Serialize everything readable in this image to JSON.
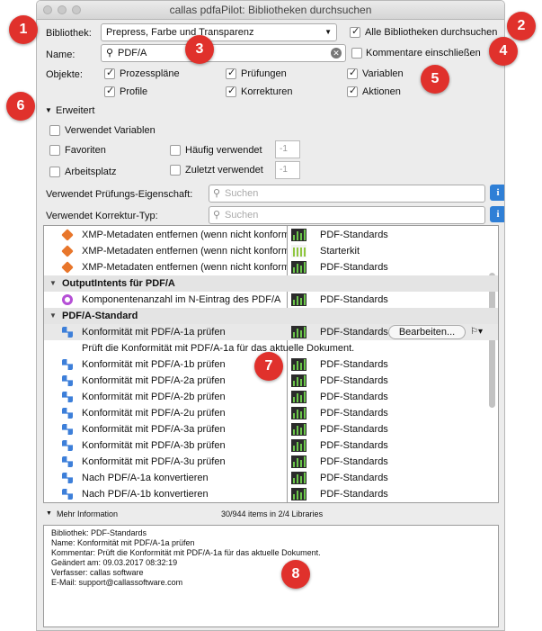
{
  "window": {
    "title": "callas pdfaPilot: Bibliotheken durchsuchen"
  },
  "form": {
    "library_label": "Bibliothek:",
    "library_value": "Prepress, Farbe und Transparenz",
    "all_libraries_label": "Alle Bibliotheken durchsuchen",
    "name_label": "Name:",
    "search_value": "PDF/A",
    "include_comments_label": "Kommentare einschließen",
    "objects_label": "Objekte:",
    "objects": [
      {
        "label": "Prozesspläne",
        "checked": true
      },
      {
        "label": "Prüfungen",
        "checked": true
      },
      {
        "label": "Variablen",
        "checked": true
      },
      {
        "label": "Profile",
        "checked": true
      },
      {
        "label": "Korrekturen",
        "checked": true
      },
      {
        "label": "Aktionen",
        "checked": true
      }
    ]
  },
  "advanced": {
    "toggle_label": "Erweitert",
    "uses_variables": "Verwendet Variablen",
    "favorites": "Favoriten",
    "workspace": "Arbeitsplatz",
    "frequently_used": "Häufig verwendet",
    "recently_used": "Zuletzt verwendet",
    "frequent_value": "-1",
    "recent_value": "-1",
    "check_property_label": "Verwendet Prüfungs-Eigenschaft:",
    "fixup_type_label": "Verwendet Korrektur-Typ:",
    "search_placeholder": "Suchen",
    "info_glyph": "i"
  },
  "list": {
    "rows": [
      {
        "kind": "item",
        "icon": "fixup-icon",
        "text": "XMP-Metadaten entfernen (wenn nicht konform)",
        "library": "PDF-Standards",
        "lib_icon": "library-chart-icon"
      },
      {
        "kind": "item",
        "icon": "fixup-icon",
        "text": "XMP-Metadaten entfernen (wenn nicht konform)",
        "library": "Starterkit",
        "lib_icon": "library-bars-icon"
      },
      {
        "kind": "item",
        "icon": "fixup-icon",
        "text": "XMP-Metadaten entfernen (wenn nicht konform)",
        "library": "PDF-Standards",
        "lib_icon": "library-chart-icon"
      },
      {
        "kind": "group",
        "text": "OutputIntents für PDF/A"
      },
      {
        "kind": "item",
        "icon": "check-circle-icon",
        "text": "Komponentenanzahl im N-Eintrag des PDF/A",
        "library": "PDF-Standards",
        "lib_icon": "library-chart-icon"
      },
      {
        "kind": "group",
        "text": "PDF/A-Standard"
      },
      {
        "kind": "item",
        "icon": "profile-icon",
        "text": "Konformität mit PDF/A-1a prüfen",
        "library": "PDF-Standards",
        "lib_icon": "library-chart-icon",
        "selected": true,
        "edit_label": "Bearbeiten..."
      },
      {
        "kind": "comment",
        "text": "Prüft die Konformität mit PDF/A-1a für das aktuelle Dokument."
      },
      {
        "kind": "item",
        "icon": "profile-icon",
        "text": "Konformität mit PDF/A-1b prüfen",
        "library": "PDF-Standards",
        "lib_icon": "library-chart-icon"
      },
      {
        "kind": "item",
        "icon": "profile-icon",
        "text": "Konformität mit PDF/A-2a prüfen",
        "library": "PDF-Standards",
        "lib_icon": "library-chart-icon"
      },
      {
        "kind": "item",
        "icon": "profile-icon",
        "text": "Konformität mit PDF/A-2b prüfen",
        "library": "PDF-Standards",
        "lib_icon": "library-chart-icon"
      },
      {
        "kind": "item",
        "icon": "profile-icon",
        "text": "Konformität mit PDF/A-2u prüfen",
        "library": "PDF-Standards",
        "lib_icon": "library-chart-icon"
      },
      {
        "kind": "item",
        "icon": "profile-icon",
        "text": "Konformität mit PDF/A-3a prüfen",
        "library": "PDF-Standards",
        "lib_icon": "library-chart-icon"
      },
      {
        "kind": "item",
        "icon": "profile-icon",
        "text": "Konformität mit PDF/A-3b prüfen",
        "library": "PDF-Standards",
        "lib_icon": "library-chart-icon"
      },
      {
        "kind": "item",
        "icon": "profile-icon",
        "text": "Konformität mit PDF/A-3u prüfen",
        "library": "PDF-Standards",
        "lib_icon": "library-chart-icon"
      },
      {
        "kind": "item",
        "icon": "profile-icon",
        "text": "Nach PDF/A-1a konvertieren",
        "library": "PDF-Standards",
        "lib_icon": "library-chart-icon"
      },
      {
        "kind": "item",
        "icon": "profile-icon",
        "text": "Nach PDF/A-1b konvertieren",
        "library": "PDF-Standards",
        "lib_icon": "library-chart-icon"
      }
    ]
  },
  "footer": {
    "more_info_label": "Mehr Information",
    "count_text": "30/944 items in 2/4 Libraries"
  },
  "details": {
    "lines": [
      "Bibliothek: PDF-Standards",
      "Name: Konformität mit PDF/A-1a prüfen",
      "Kommentar: Prüft die Konformität mit PDF/A-1a für das aktuelle Dokument.",
      "Geändert am: 09.03.2017 08:32:19",
      "Verfasser: callas software",
      "E-Mail: support@callassoftware.com"
    ]
  },
  "callouts": [
    "1",
    "2",
    "3",
    "4",
    "5",
    "6",
    "7",
    "8"
  ],
  "colors": {
    "callout": "#e0312c",
    "info_button": "#2f7fd6",
    "fixup_orange": "#e8762b",
    "profile_blue": "#3d7fd9",
    "check_purple": "#b54fd6"
  }
}
